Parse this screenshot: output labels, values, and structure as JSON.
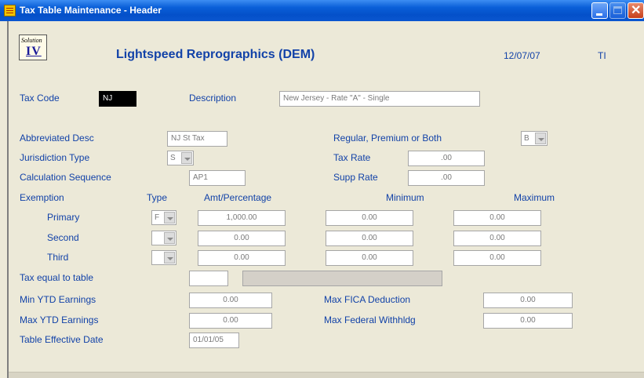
{
  "window": {
    "title": "Tax Table Maintenance - Header"
  },
  "header": {
    "logo_line1": "Solution",
    "logo_line2": "IV",
    "company": "Lightspeed Reprographics (DEM)",
    "date": "12/07/07",
    "user": "TI"
  },
  "form": {
    "tax_code": {
      "label": "Tax Code",
      "value": "NJ"
    },
    "description": {
      "label": "Description",
      "value": "New Jersey - Rate \"A\" - Single"
    },
    "abbreviated_desc": {
      "label": "Abbreviated Desc",
      "value": "NJ St Tax"
    },
    "regular_premium_both": {
      "label": "Regular, Premium or Both",
      "value": "B"
    },
    "jurisdiction_type": {
      "label": "Jurisdiction Type",
      "value": "S"
    },
    "tax_rate": {
      "label": "Tax Rate",
      "value": ".00"
    },
    "calculation_sequence": {
      "label": "Calculation Sequence",
      "value": "AP1"
    },
    "supp_rate": {
      "label": "Supp Rate",
      "value": ".00"
    },
    "exemption": {
      "label": "Exemption",
      "col_type": "Type",
      "col_amt": "Amt/Percentage",
      "col_min": "Minimum",
      "col_max": "Maximum",
      "rows": [
        {
          "label": "Primary",
          "type": "F",
          "amt": "1,000.00",
          "min": "0.00",
          "max": "0.00"
        },
        {
          "label": "Second",
          "type": "",
          "amt": "0.00",
          "min": "0.00",
          "max": "0.00"
        },
        {
          "label": "Third",
          "type": "",
          "amt": "0.00",
          "min": "0.00",
          "max": "0.00"
        }
      ]
    },
    "tax_equal_to_table": {
      "label": "Tax equal to table",
      "value": "",
      "description": ""
    },
    "min_ytd_earnings": {
      "label": "Min YTD Earnings",
      "value": "0.00"
    },
    "max_fica_deduction": {
      "label": "Max FICA Deduction",
      "value": "0.00"
    },
    "max_ytd_earnings": {
      "label": "Max YTD Earnings",
      "value": "0.00"
    },
    "max_federal_withhldg": {
      "label": "Max Federal Withhldg",
      "value": "0.00"
    },
    "table_effective_date": {
      "label": "Table Effective Date",
      "value": "01/01/05"
    }
  }
}
